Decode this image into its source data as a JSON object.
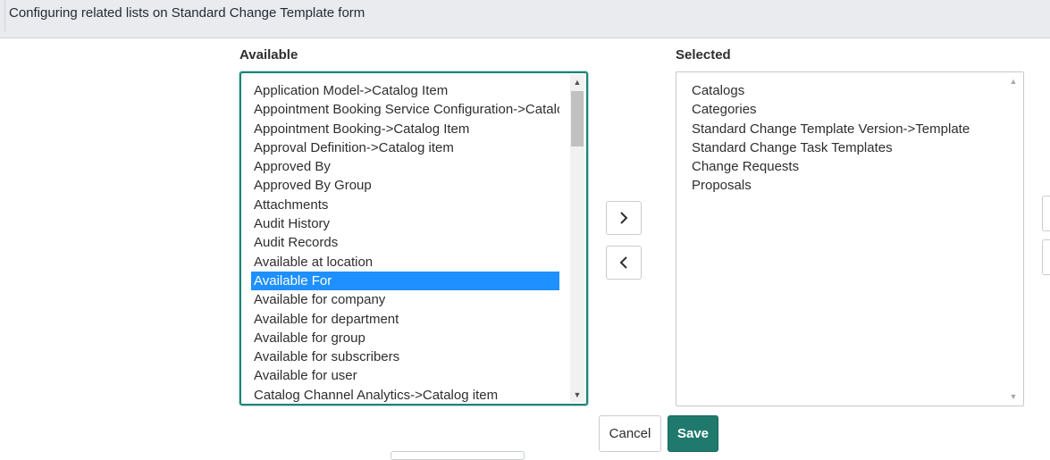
{
  "header": {
    "title": "Configuring related lists on Standard Change Template form"
  },
  "available": {
    "label": "Available",
    "items": [
      "Application Model->Catalog Item",
      "Appointment Booking Service Configuration->Catalog Item",
      "Appointment Booking->Catalog Item",
      "Approval Definition->Catalog item",
      "Approved By",
      "Approved By Group",
      "Attachments",
      "Audit History",
      "Audit Records",
      "Available at location",
      "Available For",
      "Available for company",
      "Available for department",
      "Available for group",
      "Available for subscribers",
      "Available for user",
      "Catalog Channel Analytics->Catalog item"
    ],
    "highlighted_item": "Available For"
  },
  "selected": {
    "label": "Selected",
    "items": [
      "Catalogs",
      "Categories",
      "Standard Change Template Version->Template",
      "Standard Change Task Templates",
      "Change Requests",
      "Proposals"
    ]
  },
  "controls": {
    "add_icon": "chevron-right-icon",
    "remove_icon": "chevron-left-icon"
  },
  "buttons": {
    "cancel_label": "Cancel",
    "save_label": "Save"
  },
  "colors": {
    "accent": "#1f7a6d",
    "highlight": "#1e90ff",
    "header_bg": "#e9ebee"
  }
}
